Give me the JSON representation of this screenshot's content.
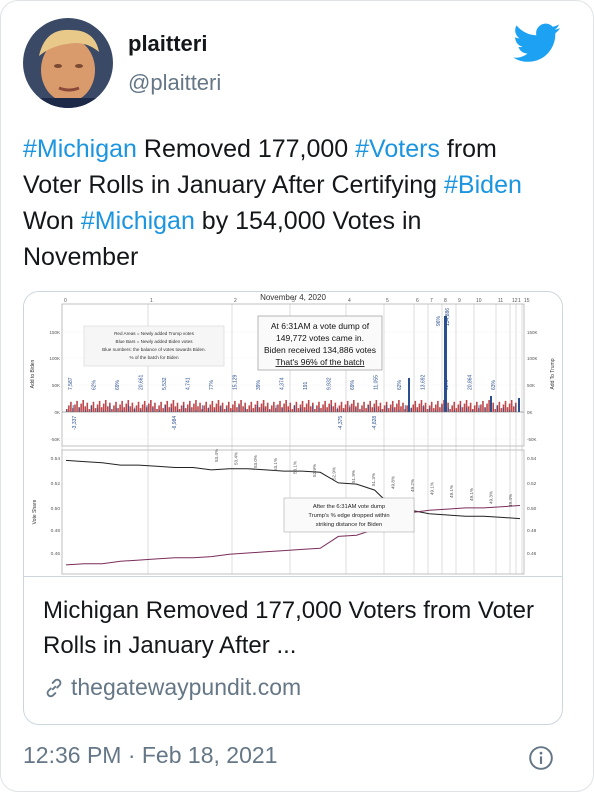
{
  "tweet": {
    "display_name": "plaitteri",
    "handle": "@plaitteri",
    "text_parts": [
      {
        "t": "#Michigan",
        "tag": true
      },
      {
        "t": " Removed 177,000 ",
        "tag": false
      },
      {
        "t": "#Voters",
        "tag": true
      },
      {
        "t": " from Voter Rolls in January After Certifying ",
        "tag": false
      },
      {
        "t": "#Biden",
        "tag": true
      },
      {
        "t": " Won ",
        "tag": false
      },
      {
        "t": "#Michigan",
        "tag": true
      },
      {
        "t": " by 154,000 Votes in November",
        "tag": false
      }
    ],
    "timestamp": "12:36 PM · Feb 18, 2021"
  },
  "link_card": {
    "title": "Michigan Removed 177,000 Voters from Voter Rolls in January After ...",
    "domain": "thegatewaypundit.com"
  },
  "icons": {
    "logo": "twitter-bird-icon",
    "link": "link-icon",
    "info": "info-icon"
  },
  "colors": {
    "accent": "#1b95e0",
    "text": "#14171a",
    "muted": "#657786",
    "trump_red": "#b0282c",
    "biden_blue": "#2a4f8f"
  },
  "chart_data": {
    "type": "line",
    "title": "November 4, 2020",
    "top_panel": {
      "y_left_label": "Add to Biden",
      "y_right_label": "Add To Trump",
      "yticks_left": [
        "150K",
        "100K",
        "50K",
        "0K",
        "-50K"
      ],
      "yticks_right": [
        "150K",
        "100K",
        "50K",
        "0K",
        "-50K"
      ],
      "x_ticks": [
        "0",
        "1",
        "2",
        "3",
        "4",
        "5",
        "6",
        "7",
        "8",
        "9",
        "10",
        "11",
        "12",
        "1",
        "15"
      ],
      "legend_lines": [
        "Red Areas = Newly added Trump votes",
        "Blue Bars = Newly added Biden votes",
        "Blue numbers: the balance of votes towards Biden.",
        "% of the batch for Biden"
      ],
      "annotation": [
        "At 6:31AM a vote dump of",
        "149,772 votes came in.",
        "Biden received 134,886 votes",
        "That's 96% of the batch"
      ],
      "bar_labels": [
        "7,587",
        "62%",
        "69%",
        "20,661",
        "5,532",
        "4,741",
        "77%",
        "15,129",
        "39%",
        "4,374",
        "191",
        "9,932",
        "69%",
        "11,055",
        "62%",
        "13,692",
        "62%",
        "20,864",
        "63%"
      ],
      "negative_labels": [
        "-3,337",
        "-6,984",
        "-4,375",
        "-4,828"
      ],
      "spike_labels": [
        "96%",
        "134,886"
      ]
    },
    "bottom_panel": {
      "y_label": "Vote Share",
      "yticks": [
        "0.54",
        "0.52",
        "0.50",
        "0.48",
        "0.46"
      ],
      "trump_labels": [
        "53.4%",
        "53.4%",
        "53.0%",
        "53.1%",
        "53.1%",
        "52.9%",
        "52.9%",
        "51.9%",
        "51.3%",
        "49.8%",
        "49.2%",
        "49.1%",
        "49.1%",
        "49.1%",
        "49.3%",
        "49.4%"
      ],
      "annotation": [
        "After the 6:31AM vote dump",
        "Trump's % edge dropped within",
        "striking distance for Biden"
      ],
      "trump_share": [
        0.538,
        0.537,
        0.536,
        0.534,
        0.534,
        0.533,
        0.532,
        0.532,
        0.53,
        0.531,
        0.531,
        0.53,
        0.529,
        0.529,
        0.528,
        0.519,
        0.518,
        0.513,
        0.498,
        0.496,
        0.493,
        0.492,
        0.491,
        0.491,
        0.49,
        0.489
      ],
      "biden_share": [
        0.45,
        0.451,
        0.451,
        0.453,
        0.454,
        0.455,
        0.456,
        0.456,
        0.457,
        0.459,
        0.46,
        0.461,
        0.462,
        0.463,
        0.464,
        0.474,
        0.475,
        0.48,
        0.493,
        0.494,
        0.496,
        0.497,
        0.498,
        0.498,
        0.499,
        0.5
      ]
    }
  }
}
